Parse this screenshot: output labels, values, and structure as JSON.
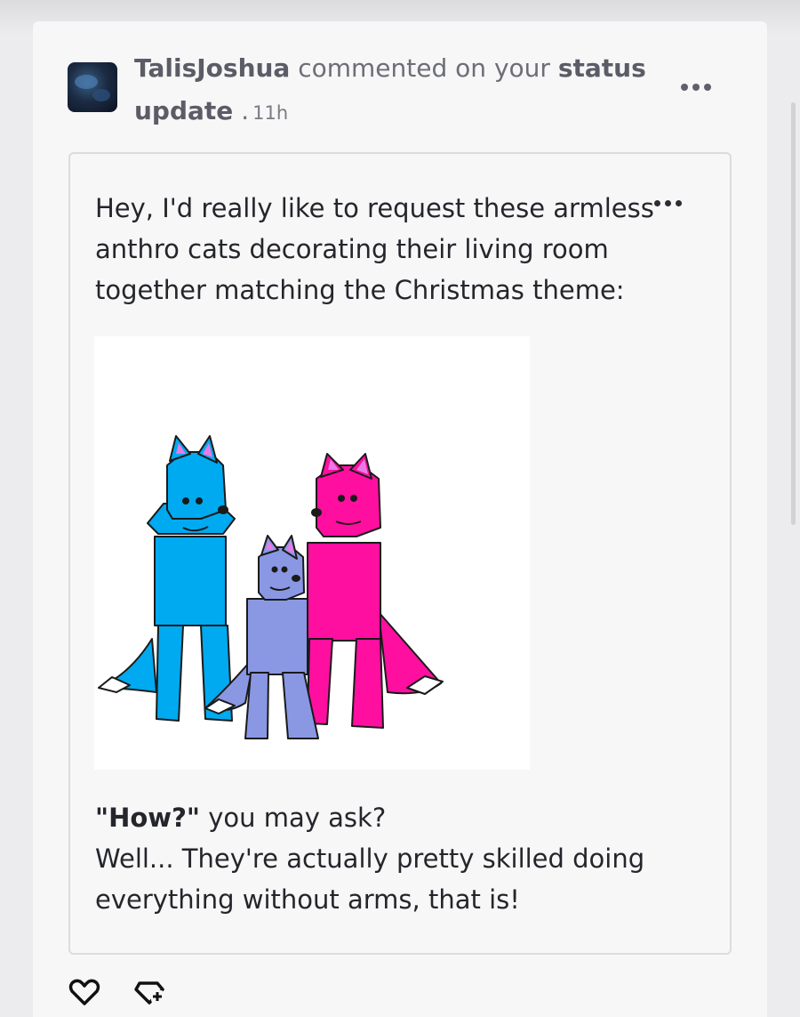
{
  "notification": {
    "username": "TalisJoshua",
    "action_text": "commented on your",
    "target_text": "status update",
    "separator": ".",
    "time": "11h"
  },
  "comment": {
    "intro": "Hey, I'd really like to request these armless anthro cats decorating their living room together matching the Christmas theme:",
    "emphasis": "\"How?\"",
    "question_rest": " you may ask?",
    "line2": "Well... They're actually pretty skilled doing everything without arms, that is!"
  },
  "image": {
    "subject": "three armless anthro cats: blue, lavender, pink",
    "colors": {
      "blue": "#00aaf0",
      "lavender": "#8a98e4",
      "pink": "#ff0fa0",
      "ear_inner": "#e97be6"
    }
  },
  "icons": [
    "more-options-icon",
    "heart-icon",
    "gem-plus-icon"
  ]
}
